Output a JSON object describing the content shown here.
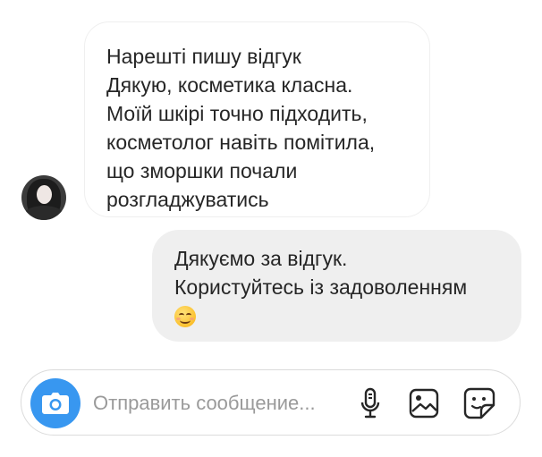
{
  "thread": {
    "incoming": {
      "lines": [
        "Нарешті пишу відгук",
        "Дякую, косметика класна.",
        "Моїй шкірі точно підходить,",
        "косметолог навіть помітила,",
        "що зморшки почали",
        "розгладжуватись"
      ]
    },
    "outgoing": {
      "lines": [
        "Дякуємо за відгук.",
        "Користуйтесь із задоволенням"
      ],
      "emoji": "smiling-face-with-smiling-eyes"
    }
  },
  "composer": {
    "placeholder": "Отправить сообщение...",
    "accent": "#3897f0",
    "icons": [
      "camera-icon",
      "microphone-icon",
      "gallery-icon",
      "sticker-icon"
    ]
  }
}
